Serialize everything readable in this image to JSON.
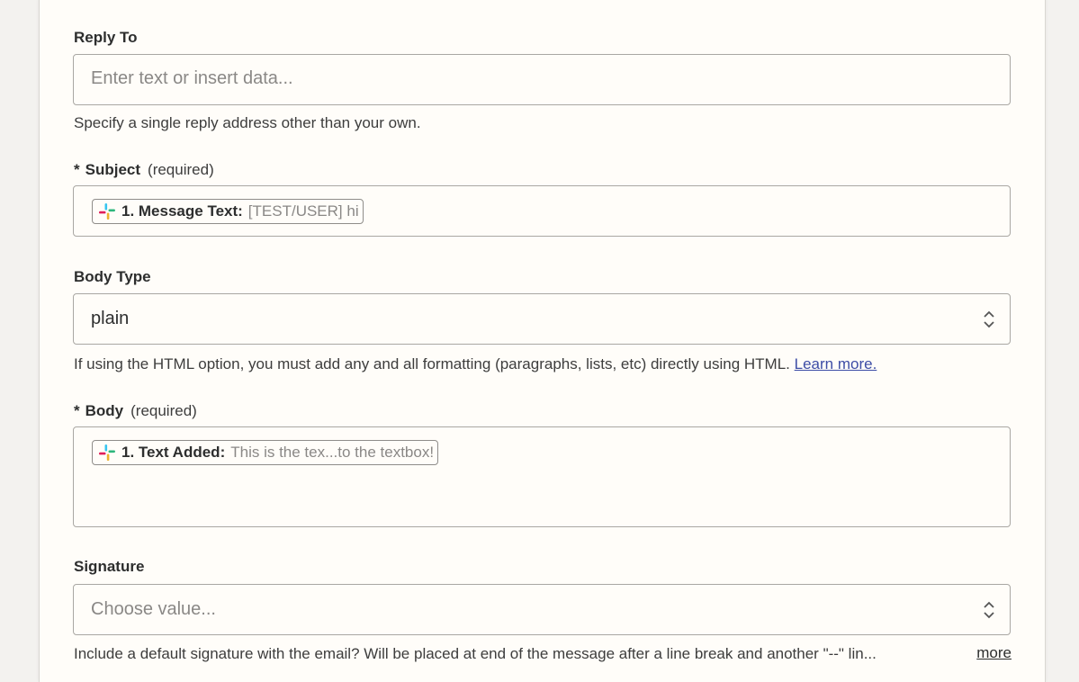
{
  "reply_to": {
    "label": "Reply To",
    "placeholder": "Enter text or insert data...",
    "help": "Specify a single reply address other than your own."
  },
  "subject": {
    "star": "*",
    "label": "Subject",
    "required": "(required)",
    "pill_key": "1. Message Text:",
    "pill_value": "[TEST/USER] hi",
    "pill_icon": "slack-icon"
  },
  "body_type": {
    "label": "Body Type",
    "value": "plain",
    "help_text": "If using the HTML option, you must add any and all formatting (paragraphs, lists, etc) directly using HTML.",
    "help_link": "Learn more."
  },
  "body": {
    "star": "*",
    "label": "Body",
    "required": "(required)",
    "pill_key": "1. Text Added:",
    "pill_value": "This is the tex...to the textbox!",
    "pill_icon": "slack-icon"
  },
  "signature": {
    "label": "Signature",
    "placeholder": "Choose value...",
    "help": "Include a default signature with the email? Will be placed at end of the message after a line break and another \"--\" lin...",
    "more": "more"
  },
  "colors": {
    "link": "#3d4da6",
    "panel_bg": "#fffdf9",
    "page_bg": "#f3f2ef"
  }
}
